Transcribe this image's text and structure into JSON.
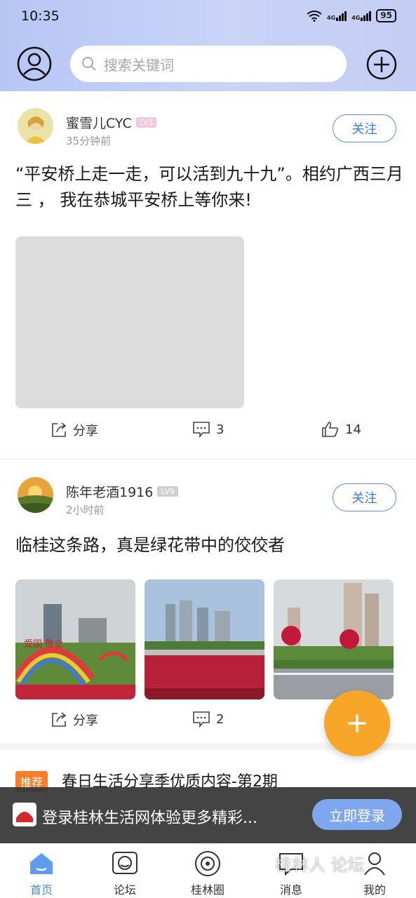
{
  "status_bar": {
    "time": "10:35",
    "network_1": "4G",
    "network_2": "4G",
    "battery": "95"
  },
  "header": {
    "search_placeholder": "搜索关键词"
  },
  "posts": [
    {
      "author": "蜜雪儿CYC",
      "level": "LV3",
      "time": "35分钟前",
      "follow_label": "关注",
      "text": "“平安桥上走一走，可以活到九十九”。相约广西三月三 ， 我在恭城平安桥上等你来!",
      "share_label": "分享",
      "comments": "3",
      "likes": "14"
    },
    {
      "author": "陈年老酒1916",
      "level": "LV9",
      "time": "2小时前",
      "follow_label": "关注",
      "text": "临桂这条路，真是绿花带中的佼佼者",
      "photo_sign_text": "爱国 敬业",
      "share_label": "分享",
      "comments": "2"
    }
  ],
  "recommend": {
    "tag": "推荐",
    "title": "春日生活分享季优质内容-第2期"
  },
  "login_banner": {
    "message": "登录桂林生活网体验更多精彩...",
    "button": "立即登录"
  },
  "tabs": [
    {
      "label": "首页",
      "icon": "home-icon",
      "active": true
    },
    {
      "label": "论坛",
      "icon": "forum-icon"
    },
    {
      "label": "桂林圈",
      "icon": "circle-icon"
    },
    {
      "label": "消息",
      "icon": "message-icon"
    },
    {
      "label": "我的",
      "icon": "profile-icon"
    }
  ],
  "watermark": "桂林人 论坛",
  "colors": {
    "accent": "#4a86e8",
    "fab": "#f7a628",
    "recommend_tag": "#f77d2a"
  }
}
